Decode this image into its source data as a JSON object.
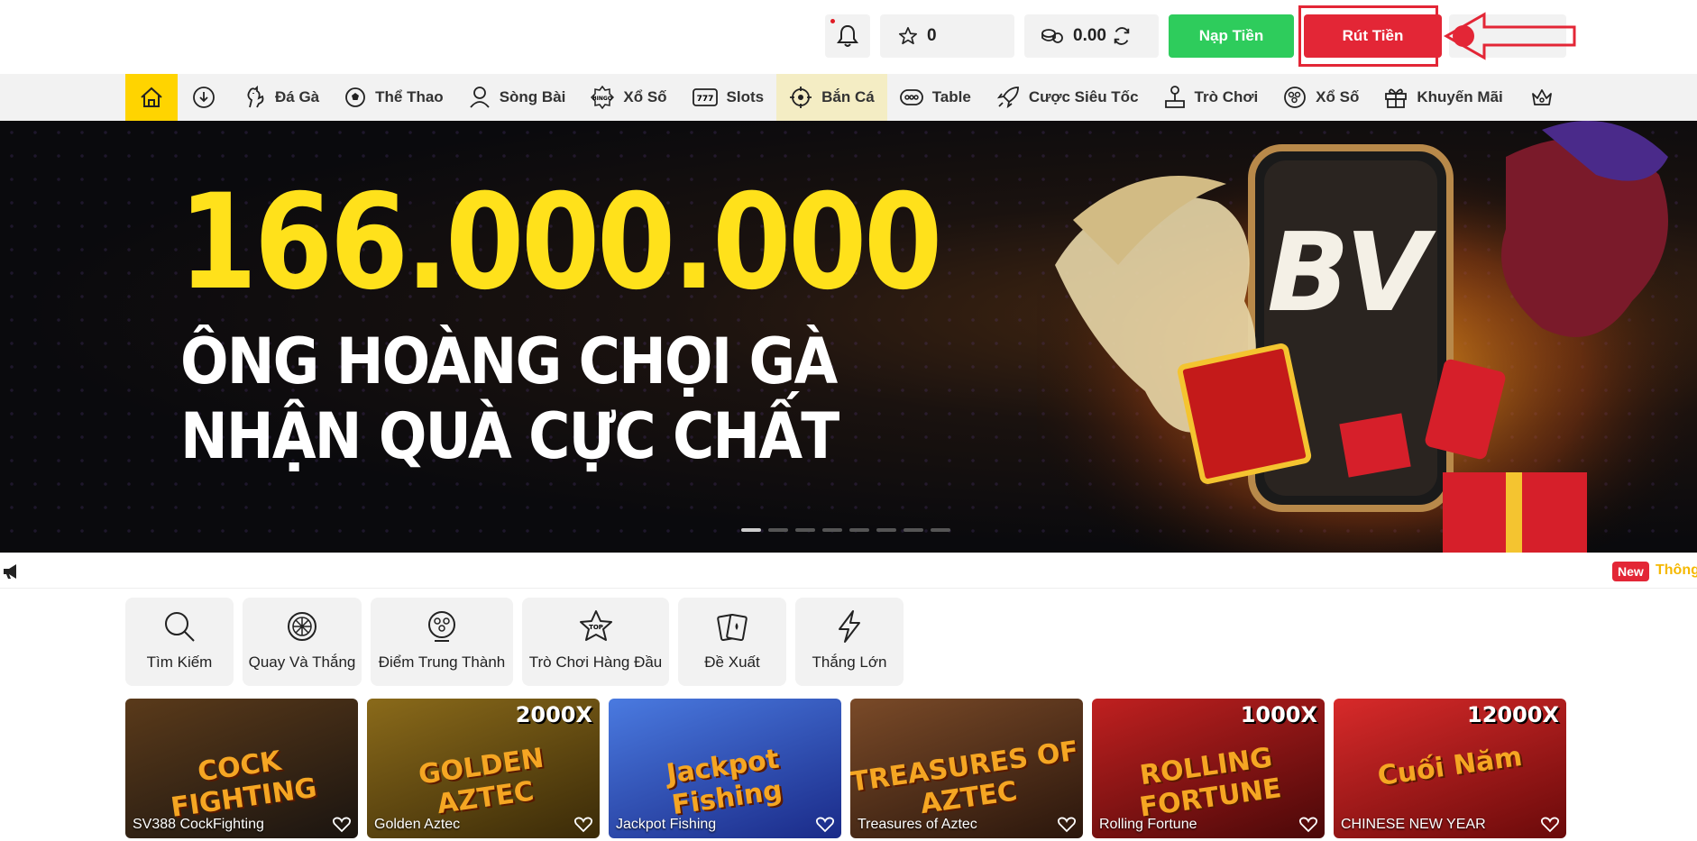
{
  "header": {
    "favorites_count": "0",
    "balance": "0.00",
    "deposit_label": "Nạp Tiền",
    "withdraw_label": "Rút Tiền"
  },
  "nav": {
    "items": [
      {
        "label": "Đá Gà",
        "icon": "rooster-icon"
      },
      {
        "label": "Thể Thao",
        "icon": "soccer-ball-icon"
      },
      {
        "label": "Sòng Bài",
        "icon": "dealer-icon"
      },
      {
        "label": "Xổ Số",
        "icon": "bingo-icon"
      },
      {
        "label": "Slots",
        "icon": "slot-machine-icon"
      },
      {
        "label": "Bắn Cá",
        "icon": "target-icon"
      },
      {
        "label": "Table",
        "icon": "table-game-icon"
      },
      {
        "label": "Cược Siêu Tốc",
        "icon": "rocket-icon"
      },
      {
        "label": "Trò Chơi",
        "icon": "joystick-icon"
      },
      {
        "label": "Xổ Số",
        "icon": "lottery-ball-icon"
      },
      {
        "label": "Khuyến Mãi",
        "icon": "gift-icon"
      }
    ]
  },
  "banner": {
    "amount": "166.000.000",
    "line1": "ÔNG HOÀNG CHỌI GÀ",
    "line2": "NHẬN QUÀ CỰC CHẤT",
    "logo": "BV"
  },
  "ticker": {
    "badge": "New",
    "text": "Thông"
  },
  "quick": [
    {
      "label": "Tìm Kiếm",
      "icon": "search-icon"
    },
    {
      "label": "Quay Và Thắng",
      "icon": "wheel-icon"
    },
    {
      "label": "Điểm Trung Thành",
      "icon": "loyalty-icon"
    },
    {
      "label": "Trò Chơi Hàng Đầu",
      "icon": "top-star-icon"
    },
    {
      "label": "Đề Xuất",
      "icon": "cards-icon"
    },
    {
      "label": "Thắng Lớn",
      "icon": "lightning-icon"
    }
  ],
  "games": [
    {
      "title": "SV388 CockFighting",
      "art": "COCK FIGHTING",
      "multiplier": "",
      "color": "#3a2a1a"
    },
    {
      "title": "Golden Aztec",
      "art": "GOLDEN AZTEC",
      "multiplier": "2000X",
      "color": "#5a4410"
    },
    {
      "title": "Jackpot Fishing",
      "art": "Jackpot Fishing",
      "multiplier": "",
      "color": "#2a4aa8"
    },
    {
      "title": "Treasures of Aztec",
      "art": "TREASURES OF AZTEC",
      "multiplier": "",
      "color": "#4a2a18"
    },
    {
      "title": "Rolling Fortune",
      "art": "ROLLING FORTUNE",
      "multiplier": "1000X",
      "color": "#8a1010"
    },
    {
      "title": "CHINESE NEW YEAR",
      "art": "Cuối Năm",
      "multiplier": "12000X",
      "color": "#a01818"
    }
  ]
}
